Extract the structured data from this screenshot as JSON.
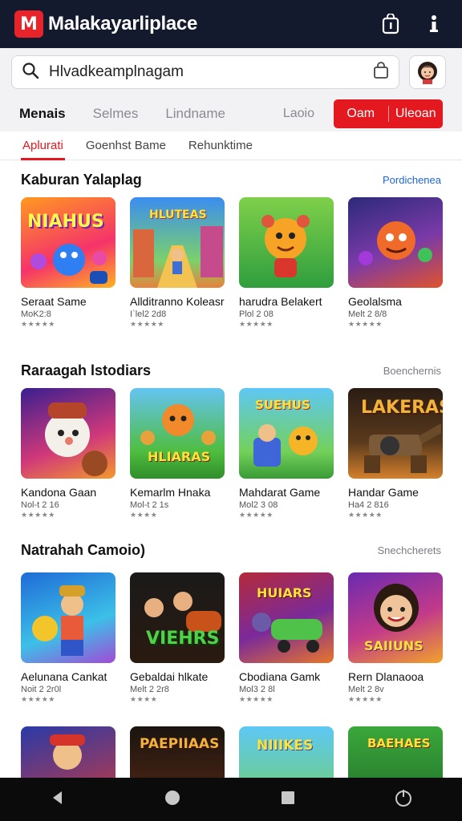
{
  "app": {
    "logo_letter": "M",
    "title": "Malakayarliplace"
  },
  "search": {
    "value": "Hlvadkeamplnagam"
  },
  "nav": {
    "items": [
      "Menais",
      "Selmes",
      "Lindname"
    ],
    "grey_link": "Laoio",
    "cta_left": "Oam",
    "cta_right": "Uleoan"
  },
  "subtabs": [
    "Aplurati",
    "Goenhst Bame",
    "Rehunktime"
  ],
  "sections": [
    {
      "title": "Kaburan Yalaplag",
      "link": "Pordichenea",
      "cards": [
        {
          "name": "Seraat Same",
          "meta": "MoK2:8",
          "stars": "★★★★★",
          "art": "NIAHUS"
        },
        {
          "name": "Allditranno Koleasr",
          "meta": "I`lel2 2d8",
          "stars": "★★★★★",
          "art": "HLUTEAS"
        },
        {
          "name": "harudra Belakert",
          "meta": "Plol 2 08",
          "stars": "★★★★★",
          "art": ""
        },
        {
          "name": "Geolalsma",
          "meta": "Melt 2 8/8",
          "stars": "★★★★★",
          "art": ""
        }
      ]
    },
    {
      "title": "Raraagah lstodiars",
      "link": "Boenchernis",
      "cards": [
        {
          "name": "Kandona Gaan",
          "meta": "Nol-t 2 16",
          "stars": "★★★★★",
          "art": ""
        },
        {
          "name": "Kemarlm Hnaka",
          "meta": "Mol-t 2 1s",
          "stars": "★★★★",
          "art": "HLIARAS"
        },
        {
          "name": "Mahdarat Game",
          "meta": "Mol2 3 08",
          "stars": "★★★★★",
          "art": "SUEHUS"
        },
        {
          "name": "Handar Game",
          "meta": "Ha4 2 816",
          "stars": "★★★★★",
          "art": "LAKERAS"
        }
      ]
    },
    {
      "title": "Natrahah Camoio)",
      "link": "Snechcherets",
      "cards": [
        {
          "name": "Aelunana Cankat",
          "meta": "Noit 2 2r0l",
          "stars": "★★★★★",
          "art": ""
        },
        {
          "name": "Gebaldai hlkate",
          "meta": "Melt 2 2r8",
          "stars": "★★★★",
          "art": "VIEHRS"
        },
        {
          "name": "Cbodiana Gamk",
          "meta": "Mol3 2 8l",
          "stars": "★★★★★",
          "art": "HUIARS"
        },
        {
          "name": "Rern Dlanaooa",
          "meta": "Melt 2 8v",
          "stars": "★★★★★",
          "art": "SAIIUNS"
        }
      ]
    },
    {
      "title": "",
      "link": "",
      "cards": [
        {
          "name": "",
          "meta": "",
          "stars": "",
          "art": ""
        },
        {
          "name": "",
          "meta": "",
          "stars": "",
          "art": "PAEPIIAAS"
        },
        {
          "name": "",
          "meta": "",
          "stars": "",
          "art": "NIIIKES"
        },
        {
          "name": "",
          "meta": "",
          "stars": "",
          "art": "BAEHAES"
        }
      ]
    }
  ],
  "colors": {
    "appbar": "#141a2e",
    "accent": "#e4191f",
    "link": "#1c66d6"
  },
  "icons": [
    "search-icon",
    "bag-icon",
    "info-icon",
    "cart-icon",
    "avatar",
    "back-icon",
    "home-icon",
    "recents-icon",
    "power-icon"
  ]
}
